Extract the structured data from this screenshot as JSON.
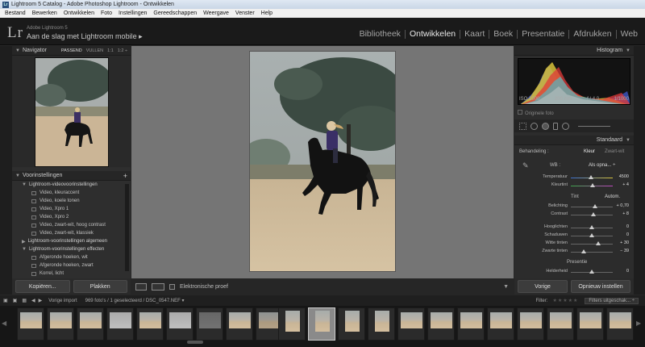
{
  "window": {
    "title": "Lightroom 5 Catalog - Adobe Photoshop Lightroom - Ontwikkelen",
    "icon": "lr-app-icon"
  },
  "menu": [
    "Bestand",
    "Bewerken",
    "Ontwikkelen",
    "Foto",
    "Instellingen",
    "Gereedschappen",
    "Weergave",
    "Venster",
    "Help"
  ],
  "identity": {
    "logo": "Lr",
    "product": "Adobe Lightroom 5",
    "subtitle": "Aan de slag met Lightroom mobile ▸"
  },
  "modules": [
    "Bibliotheek",
    "Ontwikkelen",
    "Kaart",
    "Boek",
    "Presentatie",
    "Afdrukken",
    "Web"
  ],
  "active_module": "Ontwikkelen",
  "navigator": {
    "title": "Navigator",
    "zoom": [
      "PASSEND",
      "VULLEN",
      "1:1",
      "1:2 ÷"
    ]
  },
  "presets": {
    "title": "Voorinstellingen",
    "add": "+",
    "rows": [
      {
        "type": "folder",
        "label": "Lightroom-videovoorinstellingen",
        "open": true
      },
      {
        "type": "item",
        "label": "Video, kleuraccent"
      },
      {
        "type": "item",
        "label": "Video, koele tonen"
      },
      {
        "type": "item",
        "label": "Video, Xpro 1"
      },
      {
        "type": "item",
        "label": "Video, Xpro 2"
      },
      {
        "type": "item",
        "label": "Video, zwart-wit, hoog contrast"
      },
      {
        "type": "item",
        "label": "Video, zwart-wit, klassiek"
      },
      {
        "type": "folder",
        "label": "Lightroom-voorinstellingen algemeen",
        "open": false
      },
      {
        "type": "folder",
        "label": "Lightroom-voorinstellingen effecten",
        "open": true
      },
      {
        "type": "item",
        "label": "Afgeronde hoeken, wit"
      },
      {
        "type": "item",
        "label": "Afgeronde hoeken, zwart"
      },
      {
        "type": "item",
        "label": "Korrel, licht"
      }
    ]
  },
  "left_buttons": {
    "copy": "Kopiëren...",
    "paste": "Plakken"
  },
  "toolbar": {
    "soft_proof": "Elektronische proef"
  },
  "histogram": {
    "title": "Histogram",
    "iso": "ISO 1000",
    "focal": "200 mm",
    "aperture": "f / 4,0",
    "shutter": "1/1000",
    "original": "Originele foto"
  },
  "basic": {
    "title": "Standaard",
    "treatment_label": "Behandeling :",
    "treatment_color": "Kleur",
    "treatment_bw": "Zwart-wit",
    "wb_label": "WB :",
    "wb_value": "Als opna... ÷",
    "tone_label": "Tint",
    "tone_auto": "Autom.",
    "presence_label": "Presentie",
    "sliders": [
      {
        "label": "Temperatuur",
        "value": "4500",
        "pos": 0.48
      },
      {
        "label": "Kleurtint",
        "value": "+ 4",
        "pos": 0.52
      },
      {
        "label": "Belichting",
        "value": "+ 0,70",
        "pos": 0.58
      },
      {
        "label": "Contrast",
        "value": "+ 8",
        "pos": 0.53
      },
      {
        "label": "Hooglichten",
        "value": "0",
        "pos": 0.5
      },
      {
        "label": "Schaduwen",
        "value": "0",
        "pos": 0.5
      },
      {
        "label": "Witte tinten",
        "value": "+ 30",
        "pos": 0.65
      },
      {
        "label": "Zwarte tinten",
        "value": "− 39",
        "pos": 0.3
      },
      {
        "label": "Helderheid",
        "value": "0",
        "pos": 0.5
      }
    ]
  },
  "right_buttons": {
    "previous": "Vorige",
    "reset": "Opnieuw instellen"
  },
  "filmbar": {
    "source": "Vorige import",
    "count": "969 foto's / 1 geselecteerd / DSC_0547.NEF ▾",
    "filter_label": "Filter:",
    "filter_off": "Filters uitgeschak... ÷"
  },
  "colors": {
    "panel_bg": "#2c2c2c",
    "center_bg": "#757575",
    "active_module": "#eaeaea"
  }
}
